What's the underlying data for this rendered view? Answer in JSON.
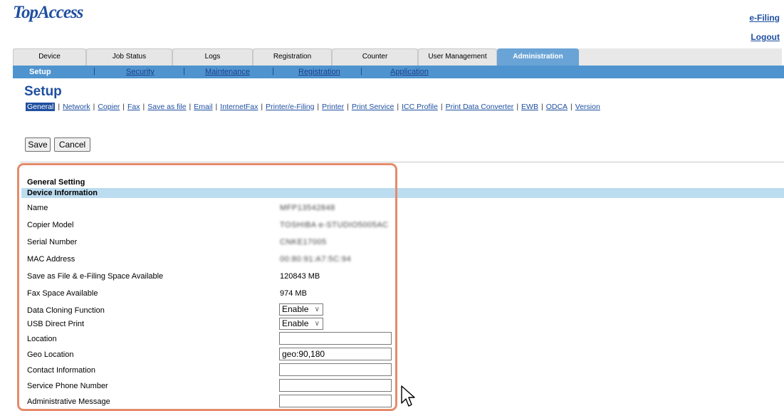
{
  "header": {
    "logo": "TopAccess",
    "efiling": "e-Filing",
    "logout": "Logout"
  },
  "tabs": [
    {
      "label": "Device"
    },
    {
      "label": "Job Status"
    },
    {
      "label": "Logs"
    },
    {
      "label": "Registration"
    },
    {
      "label": "Counter"
    },
    {
      "label": "User Management"
    },
    {
      "label": "Administration",
      "active": true
    }
  ],
  "subnav": [
    {
      "label": "Setup",
      "active": true
    },
    {
      "label": "Security"
    },
    {
      "label": "Maintenance"
    },
    {
      "label": "Registration"
    },
    {
      "label": "Application"
    }
  ],
  "page": {
    "title": "Setup"
  },
  "settings_tabs": [
    "General",
    "Network",
    "Copier",
    "Fax",
    "Save as file",
    "Email",
    "InternetFax",
    "Printer/e-Filing",
    "Printer",
    "Print Service",
    "ICC Profile",
    "Print Data Converter",
    "EWB",
    "ODCA",
    "Version"
  ],
  "buttons": {
    "save": "Save",
    "cancel": "Cancel"
  },
  "section": {
    "title": "General Setting",
    "subtitle": "Device Information"
  },
  "fields": {
    "name": {
      "label": "Name",
      "value": "MFP13542848"
    },
    "copier_model": {
      "label": "Copier Model",
      "value": "TOSHIBA e-STUDIO5005AC"
    },
    "serial": {
      "label": "Serial Number",
      "value": "CNKE17005"
    },
    "mac": {
      "label": "MAC Address",
      "value": "00:80:91:A7:5C:94"
    },
    "save_space": {
      "label": "Save as File & e-Filing Space Available",
      "value": "120843 MB"
    },
    "fax_space": {
      "label": "Fax Space Available",
      "value": "974 MB"
    },
    "cloning": {
      "label": "Data Cloning Function",
      "value": "Enable"
    },
    "usb_print": {
      "label": "USB Direct Print",
      "value": "Enable"
    },
    "location": {
      "label": "Location",
      "value": ""
    },
    "geo": {
      "label": "Geo Location",
      "value": "geo:90,180"
    },
    "contact": {
      "label": "Contact Information",
      "value": ""
    },
    "phone": {
      "label": "Service Phone Number",
      "value": ""
    },
    "admin_msg": {
      "label": "Administrative Message",
      "value": ""
    }
  },
  "colors": {
    "brand": "#1f4fa0",
    "active_tab": "#6aa4d6",
    "subnav": "#4f94cf",
    "section_bar": "#bcdcf0",
    "highlight": "#e58b6c"
  }
}
